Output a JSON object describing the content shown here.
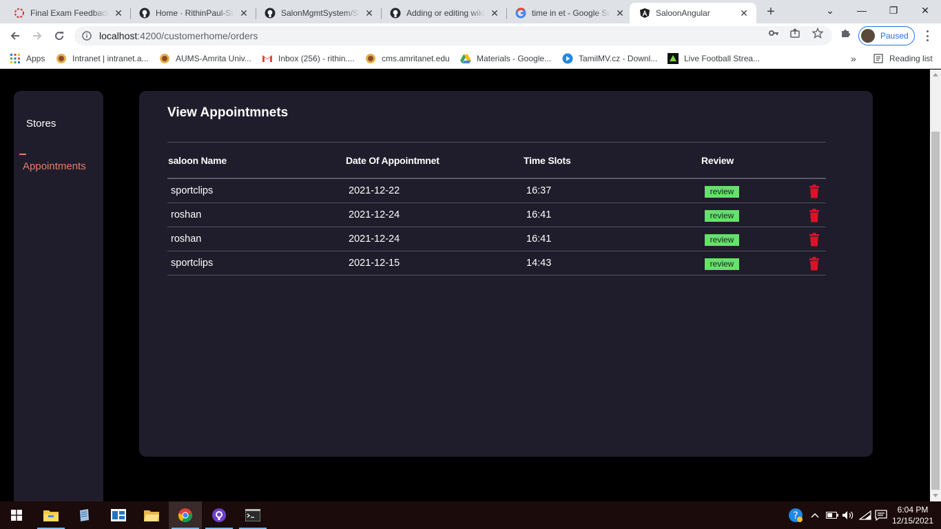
{
  "browser": {
    "tabs": [
      {
        "title": "Final Exam Feedback: S",
        "icon": "feedback-icon"
      },
      {
        "title": "Home · RithinPaul-Star",
        "icon": "github-icon"
      },
      {
        "title": "SalonMgmtSystem/Sc",
        "icon": "github-icon"
      },
      {
        "title": "Adding or editing wiki",
        "icon": "github-icon"
      },
      {
        "title": "time in et - Google Se",
        "icon": "google-icon"
      },
      {
        "title": "SaloonAngular",
        "icon": "angular-icon",
        "active": true
      }
    ],
    "address": {
      "host": "localhost",
      "path": ":4200/customerhome/orders"
    },
    "profile_label": "Paused",
    "bookmarks": [
      {
        "label": "Apps",
        "icon": "apps-grid-icon"
      },
      {
        "label": "Intranet | intranet.a...",
        "icon": "amrita-icon"
      },
      {
        "label": "AUMS-Amrita Univ...",
        "icon": "amrita-icon"
      },
      {
        "label": "Inbox (256) - rithin....",
        "icon": "gmail-icon"
      },
      {
        "label": "cms.amritanet.edu",
        "icon": "amrita-icon"
      },
      {
        "label": "Materials - Google...",
        "icon": "drive-icon"
      },
      {
        "label": "TamilMV.cz - Downl...",
        "icon": "play-icon"
      },
      {
        "label": "Live Football Strea...",
        "icon": "football-icon"
      }
    ],
    "reading_list": "Reading list",
    "more_bookmarks": "»"
  },
  "sidebar": {
    "items": [
      {
        "label": "Stores"
      },
      {
        "label": "Appointments",
        "active": true
      }
    ]
  },
  "main": {
    "title": "View Appointmnets",
    "columns": [
      "saloon Name",
      "Date Of Appointmnet",
      "Time Slots",
      "Review"
    ],
    "rows": [
      {
        "saloon": "sportclips",
        "date": "2021-12-22",
        "time": "16:37",
        "review": "review"
      },
      {
        "saloon": "roshan",
        "date": "2021-12-24",
        "time": "16:41",
        "review": "review"
      },
      {
        "saloon": "roshan",
        "date": "2021-12-24",
        "time": "16:41",
        "review": "review"
      },
      {
        "saloon": "sportclips",
        "date": "2021-12-15",
        "time": "14:43",
        "review": "review"
      }
    ]
  },
  "taskbar": {
    "time": "6:04 PM",
    "date": "12/15/2021"
  },
  "colors": {
    "accent": "#ea7c69",
    "panel": "#1f1d2b",
    "review_bg": "#64e26a",
    "trash": "#e0102a"
  }
}
